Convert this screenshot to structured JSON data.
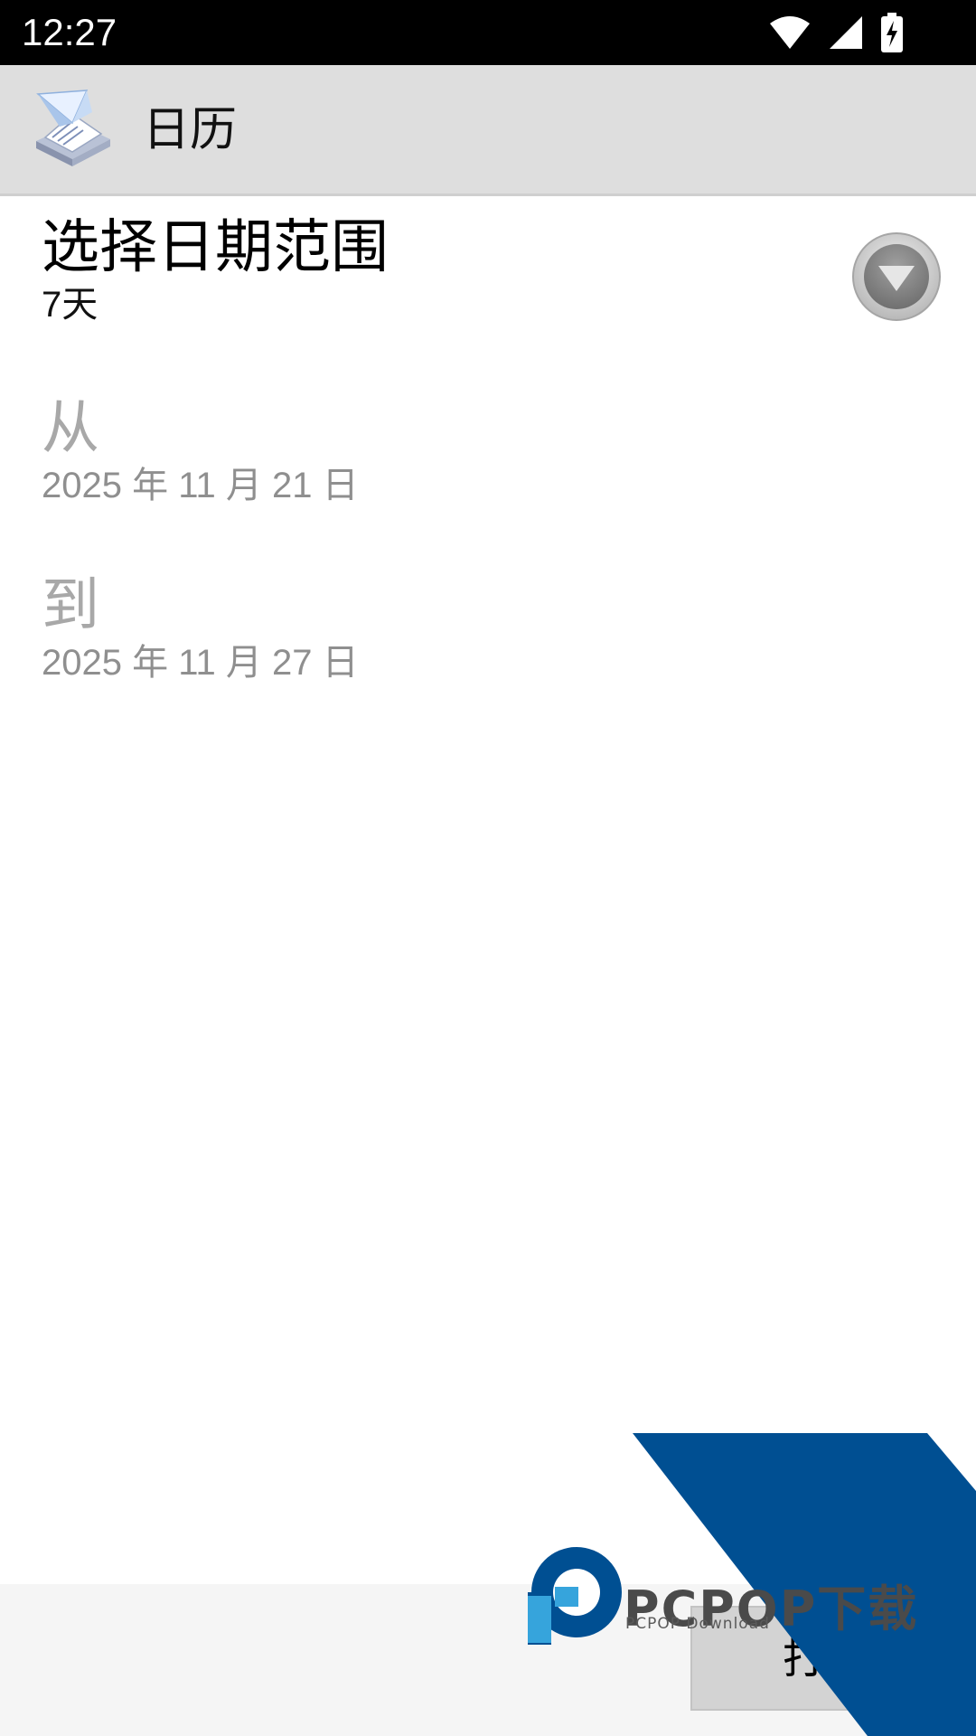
{
  "status_bar": {
    "time": "12:27",
    "icons": [
      "wifi-icon",
      "signal-icon",
      "battery-charging-icon"
    ]
  },
  "app_bar": {
    "title": "日历",
    "logo_icon": "printer-paper-icon"
  },
  "date_range": {
    "title": "选择日期范围",
    "value": "7天",
    "dropdown_icon": "dropdown-circle-icon"
  },
  "from": {
    "label": "从",
    "date": "2025 年 11 月 21 日"
  },
  "to": {
    "label": "到",
    "date": "2025 年 11 月 27 日"
  },
  "bottom": {
    "print_label": "打印"
  },
  "watermark": {
    "brand": "PCPOP下载",
    "sub": "PCPOP Download",
    "color": "#004f92"
  }
}
